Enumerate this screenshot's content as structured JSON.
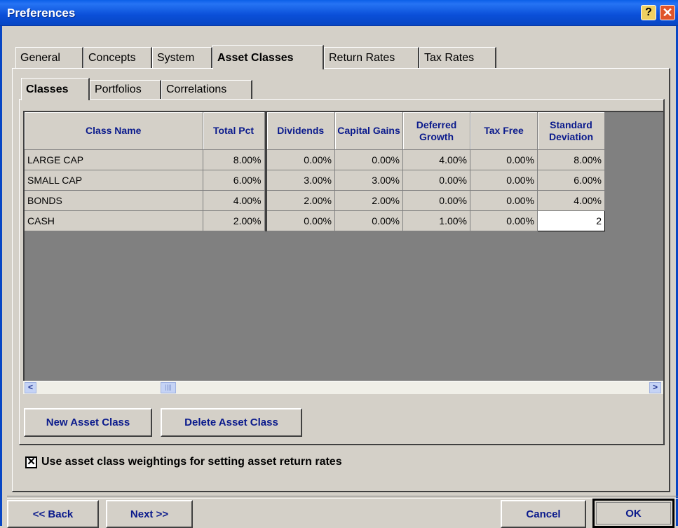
{
  "window": {
    "title": "Preferences",
    "help_glyph": "?",
    "close_glyph": "✕"
  },
  "outer_tabs": [
    "General",
    "Concepts",
    "System",
    "Asset Classes",
    "Return Rates",
    "Tax Rates"
  ],
  "inner_tabs": [
    "Classes",
    "Portfolios",
    "Correlations"
  ],
  "grid": {
    "headers": [
      "Class Name",
      "Total Pct",
      "Dividends",
      "Capital Gains",
      "Deferred Growth",
      "Tax Free",
      "Standard Deviation"
    ],
    "rows": [
      [
        "LARGE CAP",
        "8.00%",
        "0.00%",
        "0.00%",
        "4.00%",
        "0.00%",
        "8.00%"
      ],
      [
        "SMALL CAP",
        "6.00%",
        "3.00%",
        "3.00%",
        "0.00%",
        "0.00%",
        "6.00%"
      ],
      [
        "BONDS",
        "4.00%",
        "2.00%",
        "2.00%",
        "0.00%",
        "0.00%",
        "4.00%"
      ],
      [
        "CASH",
        "2.00%",
        "0.00%",
        "0.00%",
        "1.00%",
        "0.00%",
        "2"
      ]
    ]
  },
  "buttons": {
    "new_asset_class": "New Asset Class",
    "delete_asset_class": "Delete Asset Class",
    "back": "<< Back",
    "next": "Next >>",
    "cancel": "Cancel",
    "ok": "OK"
  },
  "checkbox": {
    "label": "Use asset class weightings for setting asset return rates",
    "checked_glyph": "✕"
  },
  "scrollbar": {
    "left_glyph": "<",
    "right_glyph": ">",
    "thumb_glyph": "||||"
  }
}
